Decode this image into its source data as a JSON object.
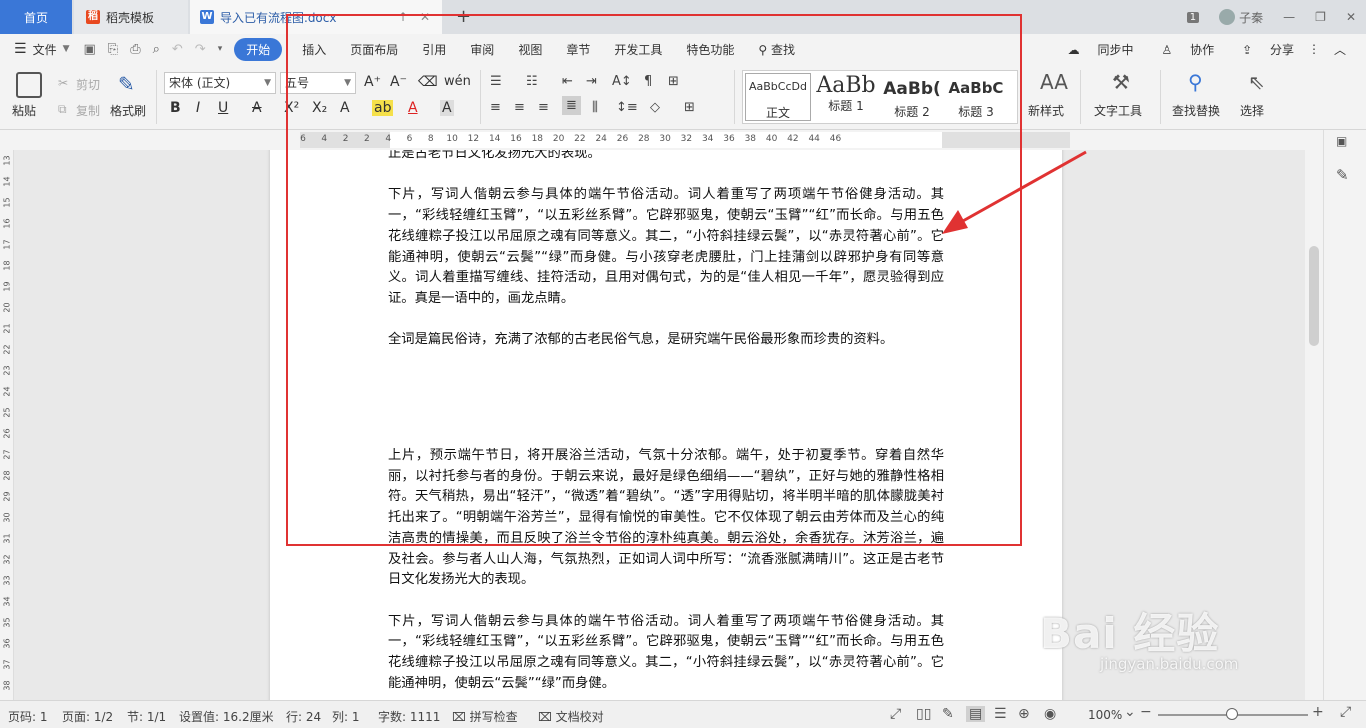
{
  "tabs": {
    "home": "首页",
    "template": "稻壳模板",
    "document": "导入已有流程图.docx",
    "template_icon": "fire-icon",
    "doc_icon": "word-doc-icon"
  },
  "window": {
    "badge": "1",
    "user": "子秦"
  },
  "menu": {
    "file": "文件",
    "items": [
      "开始",
      "插入",
      "页面布局",
      "引用",
      "审阅",
      "视图",
      "章节",
      "开发工具",
      "特色功能"
    ],
    "search": "查找",
    "right": [
      "同步中",
      "协作",
      "分享"
    ]
  },
  "ribbon": {
    "paste": "粘贴",
    "cut": "剪切",
    "copy": "复制",
    "format_painter": "格式刷",
    "font_name": "宋体 (正文)",
    "font_size": "五号",
    "styles": [
      {
        "preview": "AaBbCcDd",
        "name": "正文"
      },
      {
        "preview": "AaBb",
        "name": "标题 1"
      },
      {
        "preview": "AaBb(",
        "name": "标题 2"
      },
      {
        "preview": "AaBbC",
        "name": "标题 3"
      }
    ],
    "new_style": "新样式",
    "text_tools": "文字工具",
    "find_replace": "查找替换",
    "select": "选择"
  },
  "ruler": {
    "ticks": [
      "6",
      "4",
      "2",
      "2",
      "4",
      "6",
      "8",
      "10",
      "12",
      "14",
      "16",
      "18",
      "20",
      "22",
      "24",
      "26",
      "28",
      "30",
      "32",
      "34",
      "36",
      "38",
      "40",
      "42",
      "44",
      "46"
    ],
    "vticks": [
      "13",
      "14",
      "15",
      "16",
      "17",
      "18",
      "19",
      "20",
      "21",
      "22",
      "23",
      "24",
      "25",
      "26",
      "27",
      "28",
      "29",
      "30",
      "31",
      "32",
      "33",
      "34",
      "35",
      "36",
      "37",
      "38"
    ]
  },
  "document": {
    "p0": "正是古老节日文化发扬光大的表现。",
    "p1": "下片，写词人偕朝云参与具体的端午节俗活动。词人着重写了两项端午节俗健身活动。其一，“彩线轻缠红玉臂”，“以五彩丝系臂”。它辟邪驱鬼，使朝云“玉臂”“红”而长命。与用五色花线缠粽子投江以吊屈原之魂有同等意义。其二，“小符斜挂绿云鬓”，以“赤灵符著心前”。它能通神明，使朝云“云鬓”“绿”而身健。与小孩穿老虎腰肚，门上挂蒲剑以辟邪护身有同等意义。词人着重描写缠线、挂符活动，且用对偶句式，为的是“佳人相见一千年”，愿灵验得到应证。真是一语中的，画龙点睛。",
    "p2": "全词是篇民俗诗，充满了浓郁的古老民俗气息，是研究端午民俗最形象而珍贵的资料。",
    "p3": "上片，预示端午节日，将开展浴兰活动，气氛十分浓郁。端午，处于初夏季节。穿着自然华丽，以衬托参与者的身份。于朝云来说，最好是绿色细绢——“碧纨”，正好与她的雅静性格相符。天气稍热，易出“轻汗”，“微透”着“碧纨”。“透”字用得贴切，将半明半暗的肌体朦胧美衬托出来了。“明朝端午浴芳兰”，显得有愉悦的审美性。它不仅体现了朝云由芳体而及兰心的纯洁高贵的情操美，而且反映了浴兰令节俗的淳朴纯真美。朝云浴处，余香犹存。沐芳浴兰，遍及社会。参与者人山人海，气氛热烈，正如词人词中所写：“流香涨腻满晴川”。这正是古老节日文化发扬光大的表现。",
    "p4": "下片，写词人偕朝云参与具体的端午节俗活动。词人着重写了两项端午节俗健身活动。其一，“彩线轻缠红玉臂”，“以五彩丝系臂”。它辟邪驱鬼，使朝云“玉臂”“红”而长命。与用五色花线缠粽子投江以吊屈原之魂有同等意义。其二，“小符斜挂绿云鬓”，以“赤灵符著心前”。它能通神明，使朝云“云鬓”“绿”而身健。"
  },
  "annotation": {
    "frame_color": "#e03232"
  },
  "watermark": {
    "main": "Bai 经验",
    "sub": "jingyan.baidu.com"
  },
  "status": {
    "page_no": "页码: 1",
    "pages": "页面: 1/2",
    "section": "节: 1/1",
    "setting": "设置值: 16.2厘米",
    "row": "行: 24",
    "col": "列: 1",
    "words": "字数: 1111",
    "spell": "拼写检查",
    "proof": "文档校对",
    "zoom": "100%"
  },
  "colors": {
    "accent": "#3a77d7",
    "annotation": "#e03232"
  }
}
